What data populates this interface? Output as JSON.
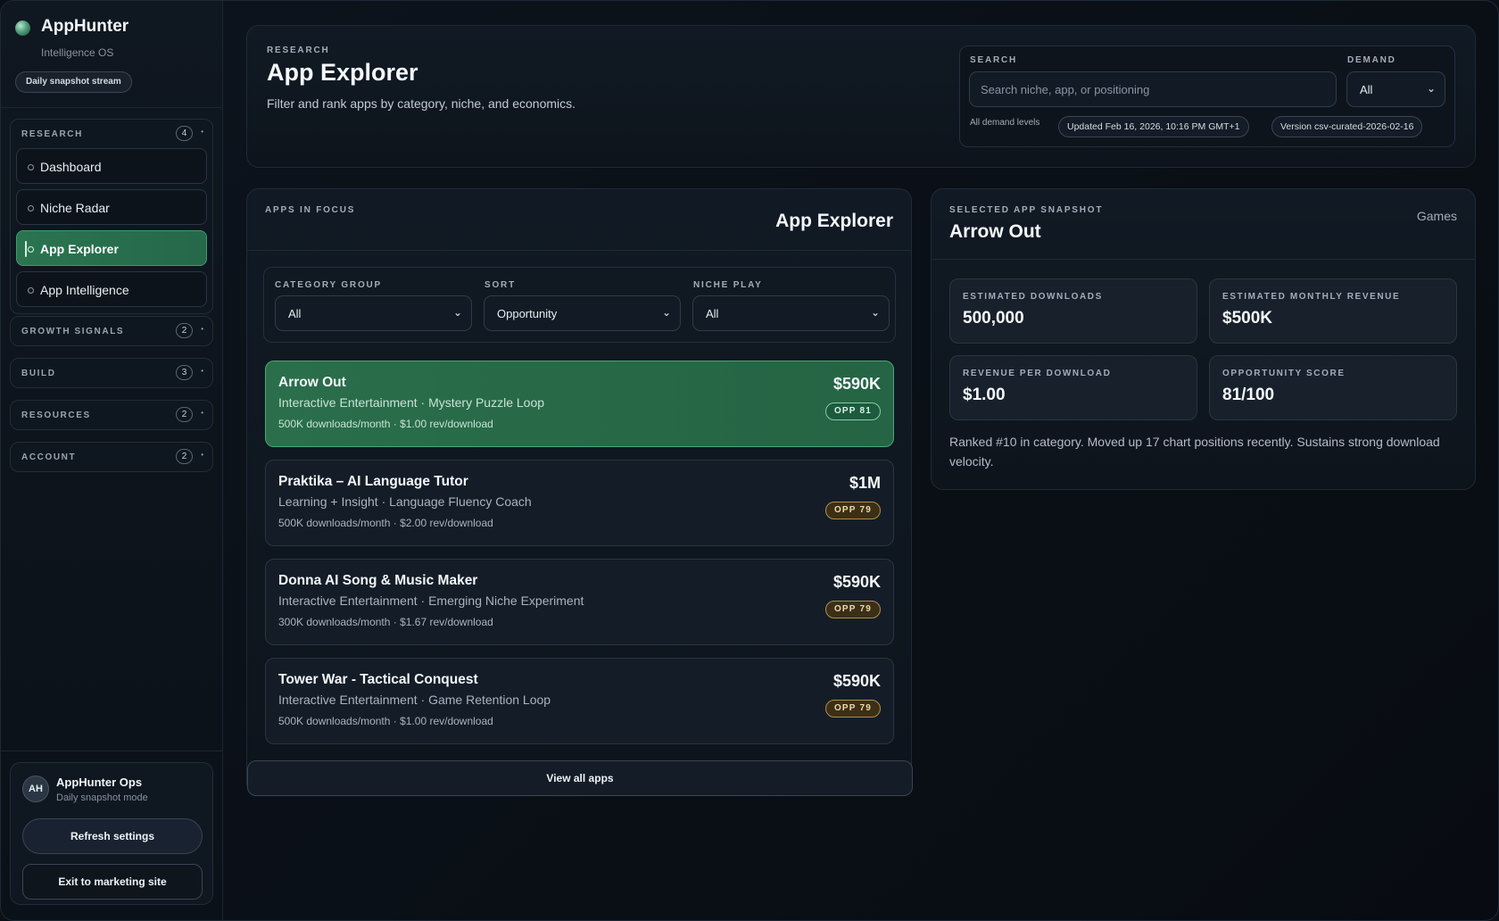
{
  "brand": {
    "name": "AppHunter",
    "subtitle": "Intelligence OS",
    "pill": "Daily snapshot stream"
  },
  "sidebar": {
    "groups": [
      {
        "title": "RESEARCH",
        "count": "4",
        "items": [
          {
            "label": "Dashboard",
            "active": false
          },
          {
            "label": "Niche Radar",
            "active": false
          },
          {
            "label": "App Explorer",
            "active": true
          },
          {
            "label": "App Intelligence",
            "active": false
          }
        ]
      },
      {
        "title": "GROWTH SIGNALS",
        "count": "2"
      },
      {
        "title": "BUILD",
        "count": "3"
      },
      {
        "title": "RESOURCES",
        "count": "2"
      },
      {
        "title": "ACCOUNT",
        "count": "2"
      }
    ],
    "user": {
      "initials": "AH",
      "name": "AppHunter Ops",
      "mode": "Daily snapshot mode",
      "refresh_label": "Refresh settings",
      "exit_label": "Exit to marketing site"
    }
  },
  "header": {
    "eyebrow": "RESEARCH",
    "title": "App Explorer",
    "description": "Filter and rank apps by category, niche, and economics.",
    "search_label": "SEARCH",
    "search_placeholder": "Search niche, app, or positioning",
    "search_value": "",
    "demand_label": "DEMAND",
    "demand_value": "All",
    "demand_note": "All demand levels",
    "updated": "Updated Feb 16, 2026, 10:16 PM GMT+1",
    "version": "Version csv-curated-2026-02-16"
  },
  "focus": {
    "eyebrow": "APPS IN FOCUS",
    "title": "App Explorer",
    "filters": {
      "category_label": "CATEGORY GROUP",
      "category_value": "All",
      "sort_label": "SORT",
      "sort_value": "Opportunity",
      "niche_label": "NICHE PLAY",
      "niche_value": "All"
    },
    "apps": [
      {
        "name": "Arrow Out",
        "category": "Interactive Entertainment · Mystery Puzzle Loop",
        "meta": "500K downloads/month · $1.00 rev/download",
        "revenue": "$590K",
        "opp": "OPP 81",
        "selected": true
      },
      {
        "name": "Praktika – AI Language Tutor",
        "category": "Learning + Insight · Language Fluency Coach",
        "meta": "500K downloads/month · $2.00 rev/download",
        "revenue": "$1M",
        "opp": "OPP 79",
        "selected": false
      },
      {
        "name": "Donna AI Song & Music Maker",
        "category": "Interactive Entertainment · Emerging Niche Experiment",
        "meta": "300K downloads/month · $1.67 rev/download",
        "revenue": "$590K",
        "opp": "OPP 79",
        "selected": false
      },
      {
        "name": "Tower War - Tactical Conquest",
        "category": "Interactive Entertainment · Game Retention Loop",
        "meta": "500K downloads/month · $1.00 rev/download",
        "revenue": "$590K",
        "opp": "OPP 79",
        "selected": false
      }
    ],
    "view_all_label": "View all apps"
  },
  "snapshot": {
    "eyebrow": "SELECTED APP SNAPSHOT",
    "title": "Arrow Out",
    "tag": "Games",
    "metrics": [
      {
        "label": "ESTIMATED DOWNLOADS",
        "value": "500,000"
      },
      {
        "label": "ESTIMATED MONTHLY REVENUE",
        "value": "$500K"
      },
      {
        "label": "REVENUE PER DOWNLOAD",
        "value": "$1.00"
      },
      {
        "label": "OPPORTUNITY SCORE",
        "value": "81/100"
      }
    ],
    "note": "Ranked #10 in category. Moved up 17 chart positions recently. Sustains strong download velocity."
  },
  "colors": {
    "accent_green": "#2b7450",
    "opp_amber": "#b48c44",
    "background": "#0b1018"
  },
  "icons": {
    "brand": "brand-orb-icon",
    "nav_bullet": "circle-bullet-icon",
    "group_caret": "caret-icon",
    "select_chevron": "chevron-down-icon"
  }
}
